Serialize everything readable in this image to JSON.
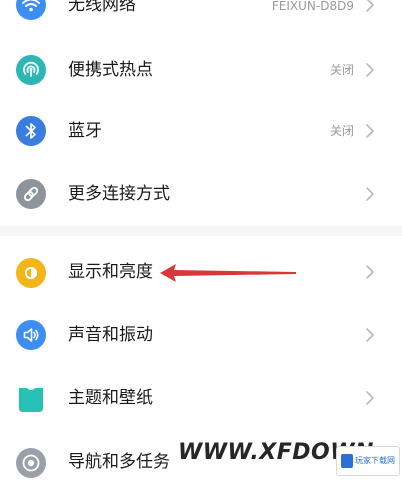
{
  "rows": [
    {
      "label": "无线网络",
      "value": "FEIXUN-D8D9",
      "icon": "wifi-icon",
      "icon_color": "#3d8ef2"
    },
    {
      "label": "便携式热点",
      "value": "关闭",
      "icon": "hotspot-icon",
      "icon_color": "#2bb7b3"
    },
    {
      "label": "蓝牙",
      "value": "关闭",
      "icon": "bluetooth-icon",
      "icon_color": "#3a7de0"
    },
    {
      "label": "更多连接方式",
      "value": "",
      "icon": "link-icon",
      "icon_color": "#8e949c"
    },
    {
      "label": "显示和亮度",
      "value": "",
      "icon": "brightness-icon",
      "icon_color": "#f2b619"
    },
    {
      "label": "声音和振动",
      "value": "",
      "icon": "speaker-icon",
      "icon_color": "#3d8ef2"
    },
    {
      "label": "主题和壁纸",
      "value": "",
      "icon": "theme-icon",
      "icon_color": "#27c2b3"
    },
    {
      "label": "导航和多任务",
      "value": "",
      "icon": "navigation-icon",
      "icon_color": "#9aa0a7"
    }
  ],
  "annotation": {
    "color": "#d9383a"
  },
  "watermark": {
    "text": "WWW.XFDOWN",
    "logo_text": "玩家下载网"
  }
}
